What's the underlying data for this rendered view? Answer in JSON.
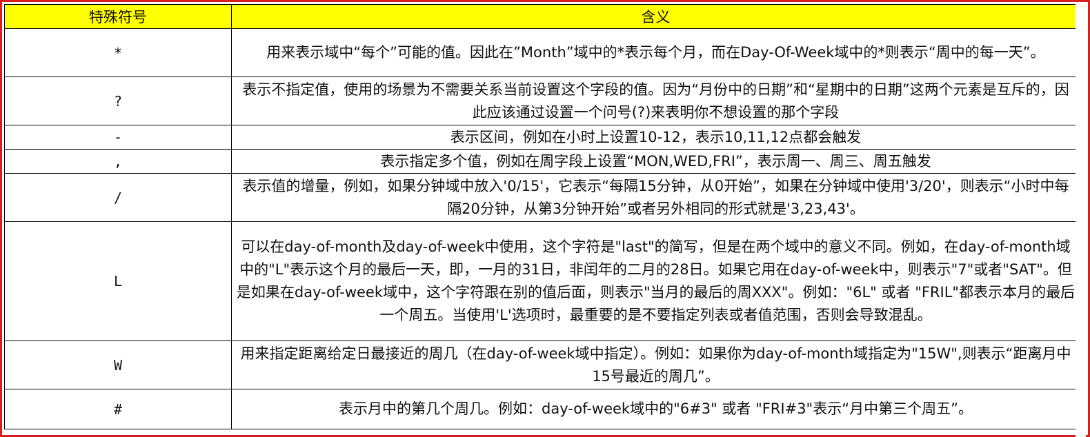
{
  "table": {
    "headers": {
      "symbol": "特殊符号",
      "meaning": "含义"
    },
    "rows": [
      {
        "symbol": "*",
        "meaning": "用来表示域中“每个”可能的值。因此在”Month”域中的*表示每个月，而在Day-Of-Week域中的*则表示“周中的每一天”。"
      },
      {
        "symbol": "?",
        "meaning": "表示不指定值，使用的场景为不需要关系当前设置这个字段的值。因为“月份中的日期”和“星期中的日期”这两个元素是互斥的，因此应该通过设置一个问号(?)来表明你不想设置的那个字段"
      },
      {
        "symbol": "-",
        "meaning": "表示区间，例如在小时上设置10-12，表示10,11,12点都会触发"
      },
      {
        "symbol": ",",
        "meaning": "表示指定多个值，例如在周字段上设置“MON,WED,FRI”，表示周一、周三、周五触发"
      },
      {
        "symbol": "/",
        "meaning": "表示值的增量，例如，如果分钟域中放入'0/15'，它表示“每隔15分钟，从0开始”，如果在分钟域中使用'3/20'，则表示“小时中每隔20分钟，从第3分钟开始”或者另外相同的形式就是'3,23,43'。"
      },
      {
        "symbol": "L",
        "meaning": "可以在day-of-month及day-of-week中使用，这个字符是\"last\"的简写，但是在两个域中的意义不同。例如，在day-of-month域中的\"L\"表示这个月的最后一天，即，一月的31日，非闰年的二月的28日。如果它用在day-of-week中，则表示\"7\"或者\"SAT\"。但是如果在day-of-week域中，这个字符跟在别的值后面，则表示\"当月的最后的周XXX\"。例如：\"6L\" 或者 \"FRIL\"都表示本月的最后一个周五。当使用'L'选项时，最重要的是不要指定列表或者值范围，否则会导致混乱。"
      },
      {
        "symbol": "W",
        "meaning": "用来指定距离给定日最接近的周几（在day-of-week域中指定）。例如：如果你为day-of-month域指定为\"15W\",则表示“距离月中15号最近的周几”。"
      },
      {
        "symbol": "#",
        "meaning": "表示月中的第几个周几。例如：day-of-week域中的\"6#3\" 或者 \"FRI#3\"表示“月中第三个周五”。"
      }
    ]
  }
}
